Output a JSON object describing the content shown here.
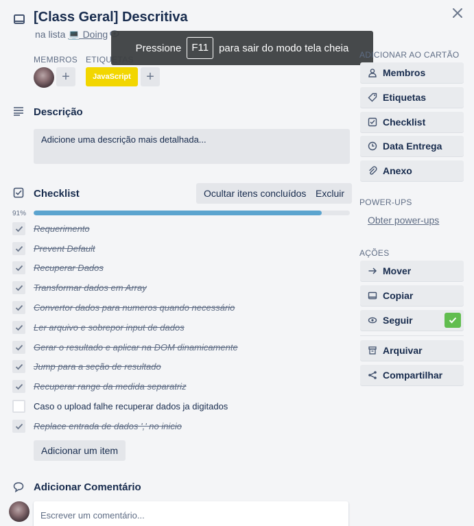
{
  "card": {
    "title": "[Class Geral] Descritiva",
    "list_prefix": "na lista",
    "list_name": "💻 Doing"
  },
  "toast": {
    "before": "Pressione",
    "key": "F11",
    "after": "para sair do modo tela cheia"
  },
  "members": {
    "heading": "MEMBROS"
  },
  "labels": {
    "heading": "ETIQUETAS",
    "items": [
      "JavaScript"
    ],
    "color": "#f2d600"
  },
  "description": {
    "heading": "Descrição",
    "placeholder": "Adicione uma descrição mais detalhada..."
  },
  "checklist": {
    "heading": "Checklist",
    "hide_button": "Ocultar itens concluídos",
    "delete_button": "Excluir",
    "progress_label": "91%",
    "progress": 0.91,
    "items": [
      {
        "text": "Requerimento",
        "done": true
      },
      {
        "text": "Prevent Default",
        "done": true
      },
      {
        "text": "Recuperar Dados",
        "done": true
      },
      {
        "text": "Transformar dados em Array",
        "done": true
      },
      {
        "text": "Convertor dados para numeros quando necessário",
        "done": true
      },
      {
        "text": "Ler arquivo e sobrepor input de dados",
        "done": true
      },
      {
        "text": "Gerar o resultado e aplicar na DOM dinamicamente",
        "done": true
      },
      {
        "text": "Jump para a seção de resultado",
        "done": true
      },
      {
        "text": "Recuperar range da medida separatriz",
        "done": true
      },
      {
        "text": "Caso o upload falhe recuperar dados ja digitados",
        "done": false
      },
      {
        "text": "Replace entrada de dados ',' no inicio",
        "done": true
      }
    ],
    "add_item_button": "Adicionar um item"
  },
  "comment": {
    "heading": "Adicionar Comentário",
    "placeholder": "Escrever um comentário..."
  },
  "sidebar": {
    "add_heading": "ADICIONAR AO CARTÃO",
    "add_buttons": [
      {
        "label": "Membros",
        "icon": "user-icon"
      },
      {
        "label": "Etiquetas",
        "icon": "tag-icon"
      },
      {
        "label": "Checklist",
        "icon": "checkbox-icon"
      },
      {
        "label": "Data Entrega",
        "icon": "clock-icon"
      },
      {
        "label": "Anexo",
        "icon": "paperclip-icon"
      }
    ],
    "powerups_heading": "POWER-UPS",
    "powerups_link": "Obter power-ups",
    "actions_heading": "AÇÕES",
    "action_buttons": [
      {
        "label": "Mover",
        "icon": "arrow-right-icon"
      },
      {
        "label": "Copiar",
        "icon": "card-icon"
      },
      {
        "label": "Seguir",
        "icon": "eye-icon"
      },
      {
        "label": "Arquivar",
        "icon": "archive-icon"
      },
      {
        "label": "Compartilhar",
        "icon": "share-icon"
      }
    ]
  },
  "colors": {
    "background": "#f4f5f7",
    "progress": "#5ba4cf",
    "follow_check": "#61bd4f",
    "label_yellow": "#f2d600"
  }
}
